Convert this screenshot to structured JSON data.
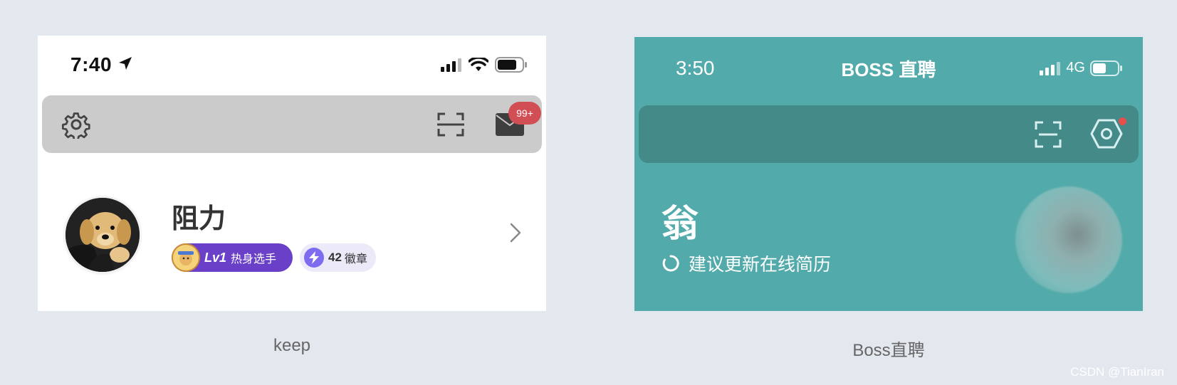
{
  "keep": {
    "status_time": "7:40",
    "mail_badge": "99+",
    "profile": {
      "name": "阻力",
      "level": "Lv1",
      "level_title": "热身选手",
      "medal_count": "42",
      "medal_label": "徽章"
    },
    "caption": "keep",
    "colors": {
      "toolbar_bg": "#cbcbcb",
      "badge": "#d24e55",
      "level_pill": "#6a40c8",
      "medal_pill": "#eceaf9"
    }
  },
  "boss": {
    "status_time": "3:50",
    "app_title": "BOSS 直聘",
    "network": "4G",
    "profile": {
      "name": "翁",
      "hint": "建议更新在线简历"
    },
    "caption": "Boss直聘",
    "colors": {
      "background": "#52abaa",
      "toolbar_bg": "#438a88",
      "notification_dot": "#e5504d"
    }
  },
  "watermark": "CSDN @TianIran"
}
